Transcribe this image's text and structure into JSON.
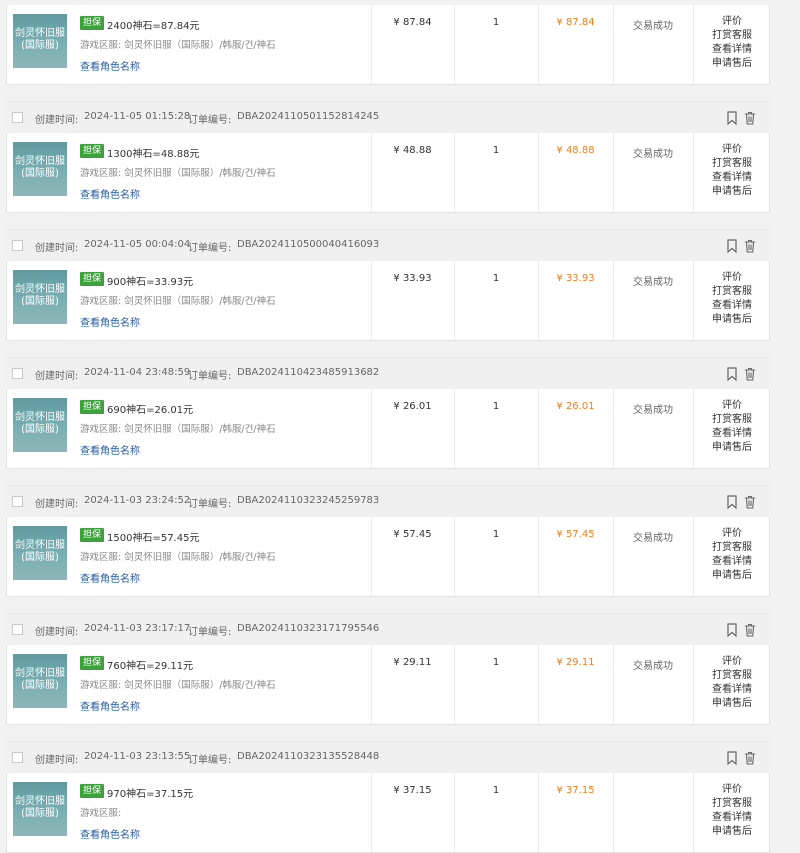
{
  "labels": {
    "created_time": "创建时间:",
    "order_no": "订单编号:",
    "guarantee_badge": "担保",
    "server_prefix": "游戏区服:",
    "view_role": "查看角色名称",
    "thumbnail_text": [
      "剑灵怀旧服",
      "(国际服)"
    ],
    "actions": [
      "评价",
      "打赏客服",
      "查看详情",
      "申请售后"
    ]
  },
  "colors": {
    "badge": "#3ea23c",
    "paid_amount": "#f07f1f",
    "link": "#285d9c"
  },
  "icons": [
    "bookmark-icon",
    "trash-icon"
  ],
  "orders": [
    {
      "created": "",
      "order_id": "",
      "product": "2400神石=87.84元",
      "server": "剑灵怀旧服（国际服）/韩服/건/神石",
      "unit_price": "¥ 87.84",
      "qty": "1",
      "paid": "¥ 87.84",
      "status": "交易成功",
      "header_visible": false
    },
    {
      "created": "2024-11-05 01:15:28",
      "order_id": "DBA2024110501152814245",
      "product": "1300神石=48.88元",
      "server": "剑灵怀旧服（国际服）/韩服/건/神石",
      "unit_price": "¥ 48.88",
      "qty": "1",
      "paid": "¥ 48.88",
      "status": "交易成功",
      "header_visible": true
    },
    {
      "created": "2024-11-05 00:04:04",
      "order_id": "DBA2024110500040416093",
      "product": "900神石=33.93元",
      "server": "剑灵怀旧服（国际服）/韩服/건/神石",
      "unit_price": "¥ 33.93",
      "qty": "1",
      "paid": "¥ 33.93",
      "status": "交易成功",
      "header_visible": true
    },
    {
      "created": "2024-11-04 23:48:59",
      "order_id": "DBA2024110423485913682",
      "product": "690神石=26.01元",
      "server": "剑灵怀旧服（国际服）/韩服/건/神石",
      "unit_price": "¥ 26.01",
      "qty": "1",
      "paid": "¥ 26.01",
      "status": "交易成功",
      "header_visible": true
    },
    {
      "created": "2024-11-03 23:24:52",
      "order_id": "DBA2024110323245259783",
      "product": "1500神石=57.45元",
      "server": "剑灵怀旧服（国际服）/韩服/건/神石",
      "unit_price": "¥ 57.45",
      "qty": "1",
      "paid": "¥ 57.45",
      "status": "交易成功",
      "header_visible": true
    },
    {
      "created": "2024-11-03 23:17:17",
      "order_id": "DBA2024110323171795546",
      "product": "760神石=29.11元",
      "server": "剑灵怀旧服（国际服）/韩服/건/神石",
      "unit_price": "¥ 29.11",
      "qty": "1",
      "paid": "¥ 29.11",
      "status": "交易成功",
      "header_visible": true
    },
    {
      "created": "2024-11-03 23:13:55",
      "order_id": "DBA2024110323135528448",
      "product": "970神石=37.15元",
      "server": "",
      "unit_price": "¥ 37.15",
      "qty": "1",
      "paid": "¥ 37.15",
      "status": "",
      "header_visible": true
    }
  ]
}
